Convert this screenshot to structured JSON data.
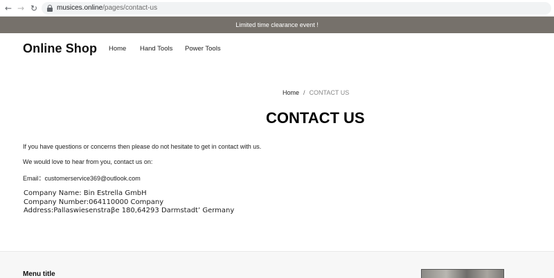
{
  "browser": {
    "back_icon": "←",
    "forward_icon": "→",
    "reload_icon": "↻",
    "url_host": "musices.online",
    "url_path": "/pages/contact-us"
  },
  "announcement": {
    "text": "Limited time clearance event !",
    "background_color": "#76716b"
  },
  "header": {
    "logo": "Online Shop",
    "nav": [
      {
        "label": "Home"
      },
      {
        "label": "Hand Tools"
      },
      {
        "label": "Power Tools"
      }
    ]
  },
  "breadcrumb": {
    "home": "Home",
    "separator": "/",
    "current": "CONTACT US"
  },
  "main": {
    "title": "CONTACT US",
    "paragraphs": [
      "If you have questions or concerns then please do not hesitate to get in contact with us.",
      "We would love to hear from you, contact us on:",
      "Email：customerservice369@outlook.com"
    ],
    "company_lines": [
      "Company Name: Bin Estrella GmbH",
      "Company Number:064110000 Company",
      "Address:Pallaswiesenstraβe 180,64293 Darmstadt’    Germany"
    ]
  },
  "footer": {
    "menu_title": "Menu title"
  }
}
